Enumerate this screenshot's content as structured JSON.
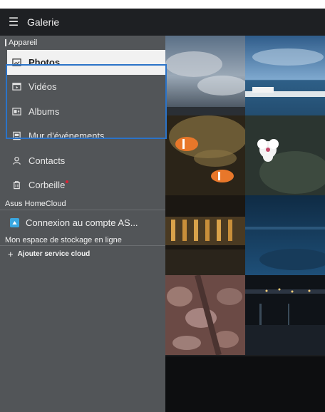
{
  "app": {
    "title": "Galerie"
  },
  "drawer": {
    "device_section": "Appareil",
    "items": [
      {
        "label": "Photos",
        "icon": "photos-icon",
        "selected": true
      },
      {
        "label": "Vidéos",
        "icon": "videos-icon"
      },
      {
        "label": "Albums",
        "icon": "albums-icon"
      },
      {
        "label": "Mur d'événements",
        "icon": "event-wall-icon"
      },
      {
        "label": "Contacts",
        "icon": "contacts-icon"
      },
      {
        "label": "Corbeille",
        "icon": "trash-icon"
      }
    ],
    "homecloud_section": "Asus HomeCloud",
    "homecloud_item": "Connexion au compte AS...",
    "storage_section": "Mon espace de stockage en ligne",
    "add_cloud": "Ajouter service cloud",
    "add_cloud_icon": "plus-icon"
  },
  "colors": {
    "accent": "#2b73c8",
    "drawer_bg": "#525558",
    "badge": "#dd2233"
  },
  "fab": {
    "icon": "plus-icon",
    "label": "+"
  }
}
